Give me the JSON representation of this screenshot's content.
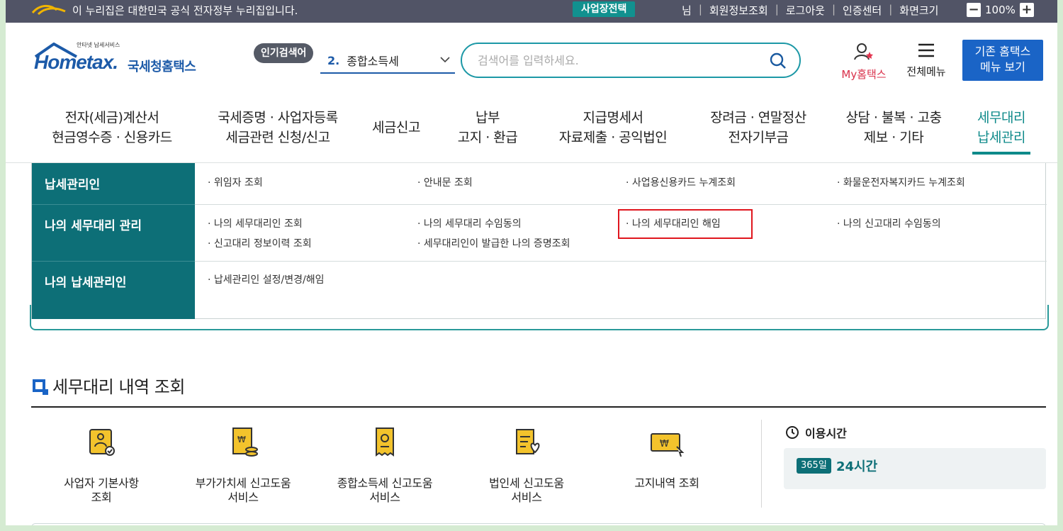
{
  "gov_bar": {
    "notice": "이 누리집은 대한민국 공식 전자정부 누리집입니다.",
    "biz_button": "사업장전택",
    "links": [
      "님",
      "회원정보조회",
      "로그아웃",
      "인증센터",
      "화면크기"
    ],
    "zoom_minus": "−",
    "zoom_value": "100%",
    "zoom_plus": "+"
  },
  "header": {
    "logo_small": "안타넷 납세서비스",
    "logo_main": "Hometax.",
    "logo_kr": "국세청홈택스",
    "popular_badge": "인기검색어",
    "popular_rank": "2.",
    "popular_term": "종합소득세",
    "search_placeholder": "검색어를 입력하세요.",
    "my_hometax": "My홈택스",
    "all_menu": "전체메뉴",
    "legacy_line1": "기존 홈택스",
    "legacy_line2": "메뉴 보기"
  },
  "gnb": [
    {
      "line1": "전자(세금)계산서",
      "line2": "현금영수증 · 신용카드"
    },
    {
      "line1": "국세증명 · 사업자등록",
      "line2": "세금관련 신청/신고"
    },
    {
      "line1": "세금신고",
      "line2": ""
    },
    {
      "line1": "납부",
      "line2": "고지 · 환급"
    },
    {
      "line1": "지급명세서",
      "line2": "자료제출 · 공익법인"
    },
    {
      "line1": "장려금 · 연말정산",
      "line2": "전자기부금"
    },
    {
      "line1": "상담 · 불복 · 고충",
      "line2": "제보 · 기타"
    },
    {
      "line1": "세무대리",
      "line2": "납세관리"
    }
  ],
  "mega": {
    "rows": [
      {
        "title": "납세관리인",
        "links": [
          "위임자 조회",
          "안내문 조회",
          "사업용신용카드 누계조회",
          "화물운전자복지카드 누계조회"
        ]
      },
      {
        "title": "나의 세무대리 관리",
        "links": [
          "나의 세무대리인 조회",
          "나의 세무대리 수임동의",
          "나의 세무대리인 해임",
          "나의 신고대리 수임동의",
          "신고대리 정보이력 조회",
          "세무대리인이 발급한 나의 증명조회"
        ]
      },
      {
        "title": "나의 납세관리인",
        "links": [
          "납세관리인 설정/변경/해임"
        ]
      }
    ]
  },
  "section": {
    "title": "세무대리 내역 조회",
    "services": [
      {
        "line1": "사업자 기본사항",
        "line2": "조회"
      },
      {
        "line1": "부가가치세 신고도움",
        "line2": "서비스"
      },
      {
        "line1": "종합소득세 신고도움",
        "line2": "서비스"
      },
      {
        "line1": "법인세 신고도움",
        "line2": "서비스"
      },
      {
        "line1": "고지내역 조회",
        "line2": ""
      }
    ],
    "usage_title": "이용시간",
    "usage_badge": "365일",
    "usage_hours": "24시간"
  },
  "colors": {
    "teal": "#0d6f77",
    "brand_blue": "#1a64c6",
    "highlight_red": "#e0161e"
  }
}
